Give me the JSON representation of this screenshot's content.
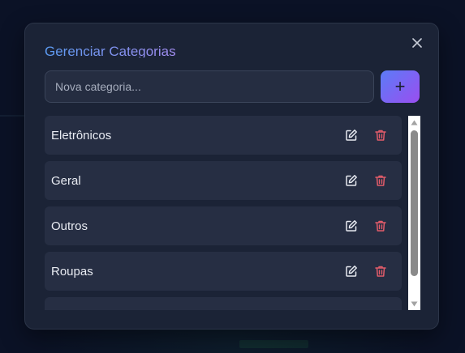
{
  "dialog": {
    "title": "Gerenciar Categorias",
    "close_icon": "close-icon"
  },
  "new_category": {
    "placeholder": "Nova categoria...",
    "value": "",
    "add_label": "+"
  },
  "categories": [
    {
      "label": "Eletrônicos"
    },
    {
      "label": "Geral"
    },
    {
      "label": "Outros"
    },
    {
      "label": "Roupas"
    },
    {
      "label": ""
    }
  ],
  "icons": {
    "edit": "edit-icon",
    "delete": "trash-icon"
  },
  "colors": {
    "title_gradient_start": "#5b9bf2",
    "title_gradient_end": "#a28cf0",
    "add_gradient_start": "#5b7cf7",
    "add_gradient_end": "#9a4ef0",
    "delete_icon": "#e25c6a",
    "edit_icon": "#e6e9f0",
    "modal_bg": "#1b2336",
    "item_bg": "#262e43"
  }
}
